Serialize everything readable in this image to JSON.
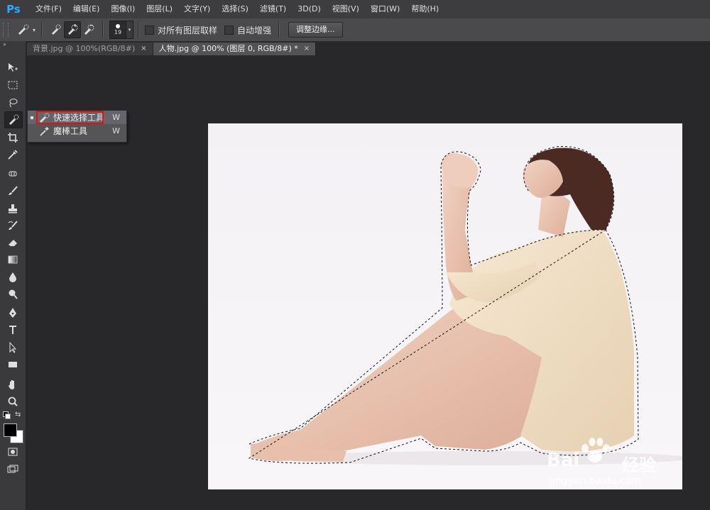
{
  "app": {
    "logo": "Ps"
  },
  "menu": [
    "文件(F)",
    "编辑(E)",
    "图像(I)",
    "图层(L)",
    "文字(Y)",
    "选择(S)",
    "滤镜(T)",
    "3D(D)",
    "视图(V)",
    "窗口(W)",
    "帮助(H)"
  ],
  "options": {
    "brush_size": "19",
    "sample_all_layers": "对所有图层取样",
    "sample_all_layers_checked": false,
    "auto_enhance": "自动增强",
    "auto_enhance_checked": false,
    "refine_edge": "调整边缘..."
  },
  "tabs": [
    {
      "label": "背景.jpg @ 100%(RGB/8#)",
      "close": "×",
      "active": false
    },
    {
      "label": "人物.jpg @ 100% (图层 0, RGB/8#) *",
      "close": "×",
      "active": true
    }
  ],
  "toolbar": {
    "collapse": "»",
    "tools": [
      "move-icon",
      "marquee-icon",
      "lasso-icon",
      "quick-selection-icon",
      "crop-icon",
      "eyedropper-icon",
      "spot-healing-icon",
      "brush-icon",
      "stamp-icon",
      "history-brush-icon",
      "eraser-icon",
      "gradient-icon",
      "blur-icon",
      "dodge-icon",
      "pen-icon",
      "type-icon",
      "path-selection-icon",
      "rectangle-icon",
      "hand-icon",
      "zoom-icon"
    ],
    "selected_tool": "quick-selection-icon",
    "foreground_color": "#000000",
    "background_color": "#ffffff"
  },
  "flyout": {
    "items": [
      {
        "label": "快速选择工具",
        "shortcut": "W",
        "icon": "quick-selection-icon",
        "selected": true
      },
      {
        "label": "魔棒工具",
        "shortcut": "W",
        "icon": "magic-wand-icon",
        "selected": false
      }
    ]
  },
  "watermark": {
    "brand": "Bai",
    "brand2": "经验",
    "url": "jingyan.baidu.com"
  },
  "colors": {
    "accent_logo": "#31a8ff",
    "highlight": "#dd1111",
    "canvas_bg": "#f7f3f6"
  }
}
